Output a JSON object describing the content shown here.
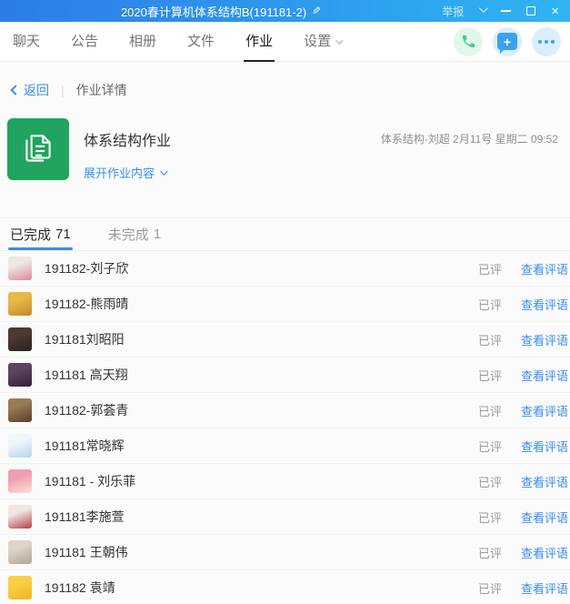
{
  "colors": {
    "accent": "#3a8cf0",
    "tb1": "#2d7ce7",
    "tb2": "#2fb4f3",
    "green": "#21a45f",
    "phone_green": "#3ed08c",
    "phone_bg": "#e1f7ec",
    "chat_blue": "#3aa2f2",
    "icon_bg_blue": "#d9effc",
    "nav_gray": "#757575",
    "text_dark": "#333333"
  },
  "titlebar": {
    "title": "2020春计算机体系结构B(191181-2)",
    "report_label": "举报",
    "close_glyph": "×"
  },
  "navbar": {
    "tabs": [
      {
        "label": "聊天"
      },
      {
        "label": "公告"
      },
      {
        "label": "相册"
      },
      {
        "label": "文件"
      },
      {
        "label": "作业"
      },
      {
        "label": "设置"
      }
    ],
    "icons": [
      "phone-icon",
      "chat-plus-icon",
      "more-icon"
    ]
  },
  "breadcrumb": {
    "back_label": "返回",
    "divider": "|",
    "title": "作业详情"
  },
  "homework": {
    "title": "体系结构作业",
    "expand_label": "展开作业内容",
    "author": "体系结构-刘超",
    "datetime": "2月11号 星期二 09:52",
    "icon": "homework-document-icon"
  },
  "status_tabs": [
    {
      "label": "已完成",
      "count": "71",
      "active": true
    },
    {
      "label": "未完成",
      "count": "1",
      "active": false
    }
  ],
  "list": {
    "rows": [
      {
        "name": "191182-刘子欣",
        "status": "已评",
        "action": "查看评语",
        "avatar_colors": [
          "#efe7e3",
          "#d98a96"
        ]
      },
      {
        "name": "191182-熊雨晴",
        "status": "已评",
        "action": "查看评语",
        "avatar_colors": [
          "#e9b848",
          "#c7882d"
        ]
      },
      {
        "name": "191181刘昭阳",
        "status": "已评",
        "action": "查看评语",
        "avatar_colors": [
          "#4a3a33",
          "#2c221e"
        ]
      },
      {
        "name": "191181 高天翔",
        "status": "已评",
        "action": "查看评语",
        "avatar_colors": [
          "#5c4560",
          "#30212d"
        ]
      },
      {
        "name": "191182-郭荟青",
        "status": "已评",
        "action": "查看评语",
        "avatar_colors": [
          "#9a7a53",
          "#55412c"
        ]
      },
      {
        "name": "191181常晓辉",
        "status": "已评",
        "action": "查看评语",
        "avatar_colors": [
          "#f3f6f9",
          "#b6d5ee"
        ]
      },
      {
        "name": "191181 - 刘乐菲",
        "status": "已评",
        "action": "查看评语",
        "avatar_colors": [
          "#f09cb2",
          "#fbe3d3"
        ]
      },
      {
        "name": "191181李施萱",
        "status": "已评",
        "action": "查看评语",
        "avatar_colors": [
          "#f0e6e4",
          "#b24048"
        ]
      },
      {
        "name": "191181 王朝伟",
        "status": "已评",
        "action": "查看评语",
        "avatar_colors": [
          "#ddd5cc",
          "#b4a493"
        ]
      },
      {
        "name": "191182 袁靖",
        "status": "已评",
        "action": "查看评语",
        "avatar_colors": [
          "#f8cf45",
          "#efb728"
        ]
      }
    ]
  }
}
